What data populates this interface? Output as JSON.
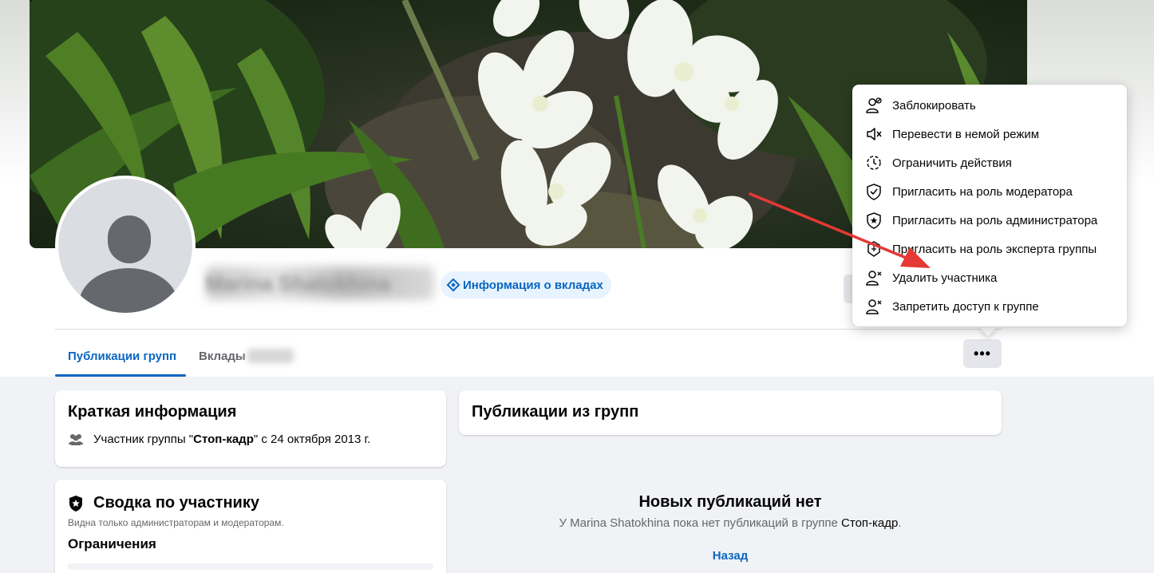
{
  "profile": {
    "name_blurred": "Marina Shatokhina",
    "tab_info_button": "Информация о вкладах"
  },
  "tabs": {
    "group_posts": "Публикации групп",
    "contributions": "Вклады"
  },
  "more_button": "•••",
  "menu": {
    "items": [
      {
        "label": "Заблокировать",
        "icon": "block-user-icon"
      },
      {
        "label": "Перевести в немой режим",
        "icon": "mute-icon"
      },
      {
        "label": "Ограничить действия",
        "icon": "restrict-icon"
      },
      {
        "label": "Пригласить на роль модератора",
        "icon": "moderator-shield-icon"
      },
      {
        "label": "Пригласить на роль администратора",
        "icon": "admin-shield-star-icon"
      },
      {
        "label": "Пригласить на роль эксперта группы",
        "icon": "expert-badge-icon"
      },
      {
        "label": "Удалить участника",
        "icon": "remove-user-icon"
      },
      {
        "label": "Запретить доступ к группе",
        "icon": "ban-user-icon"
      }
    ]
  },
  "intro": {
    "title": "Краткая информация",
    "member_prefix": "Участник группы \"",
    "group_name": "Стоп-кадр",
    "member_suffix": "\" с 24 октября 2013 г."
  },
  "summary": {
    "title": "Сводка по участнику",
    "visibility_note": "Видна только администраторам и модераторам.",
    "restrictions_label": "Ограничения"
  },
  "posts": {
    "title": "Публикации из групп",
    "empty_title": "Новых публикаций нет",
    "empty_text_prefix": "У Marina Shatokhina пока нет публикаций в группе ",
    "empty_group": "Стоп-кадр",
    "empty_text_suffix": ".",
    "back_link": "Назад"
  },
  "colors": {
    "accent": "#0a66c2",
    "annotation_arrow": "#e53935"
  }
}
